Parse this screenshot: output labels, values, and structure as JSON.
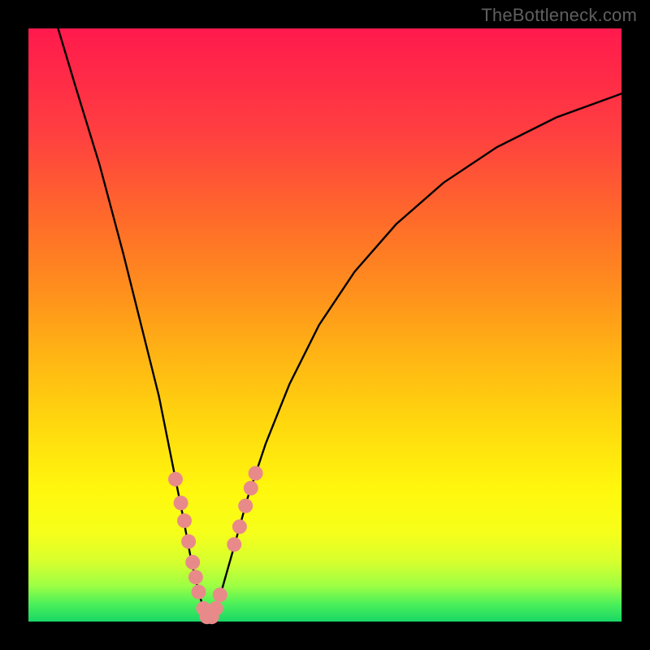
{
  "watermark": "TheBottleneck.com",
  "chart_data": {
    "type": "line",
    "title": "",
    "xlabel": "",
    "ylabel": "",
    "xlim": [
      0,
      100
    ],
    "ylim": [
      0,
      100
    ],
    "gradient_colors": {
      "top": "#ff1a4d",
      "upper_mid": "#ff921c",
      "mid": "#ffd60e",
      "lower_mid": "#fff80d",
      "bottom": "#18d765"
    },
    "series": [
      {
        "name": "bottleneck_curve",
        "x": [
          5,
          8,
          12,
          16,
          19,
          22,
          24,
          26,
          27.5,
          28.7,
          29.7,
          30.5,
          31.3,
          32.5,
          34.5,
          37,
          40,
          44,
          49,
          55,
          62,
          70,
          79,
          89,
          100
        ],
        "y": [
          100,
          90,
          77,
          62,
          50,
          38,
          28,
          18,
          10,
          5,
          1.5,
          0.3,
          1.5,
          5,
          12,
          21,
          30,
          40,
          50,
          59,
          67,
          74,
          80,
          85,
          89
        ]
      }
    ],
    "markers": {
      "name": "highlighted_points",
      "color": "#e98a8a",
      "radius": 9,
      "points": [
        {
          "x": 24.8,
          "y": 24
        },
        {
          "x": 25.7,
          "y": 20
        },
        {
          "x": 26.3,
          "y": 17
        },
        {
          "x": 27.0,
          "y": 13.5
        },
        {
          "x": 27.7,
          "y": 10
        },
        {
          "x": 28.2,
          "y": 7.5
        },
        {
          "x": 28.7,
          "y": 5
        },
        {
          "x": 29.5,
          "y": 2.2
        },
        {
          "x": 30.1,
          "y": 0.8
        },
        {
          "x": 30.9,
          "y": 0.8
        },
        {
          "x": 31.6,
          "y": 2.2
        },
        {
          "x": 32.3,
          "y": 4.5
        },
        {
          "x": 34.7,
          "y": 13
        },
        {
          "x": 35.6,
          "y": 16
        },
        {
          "x": 36.6,
          "y": 19.5
        },
        {
          "x": 37.5,
          "y": 22.5
        },
        {
          "x": 38.3,
          "y": 25
        }
      ]
    }
  }
}
